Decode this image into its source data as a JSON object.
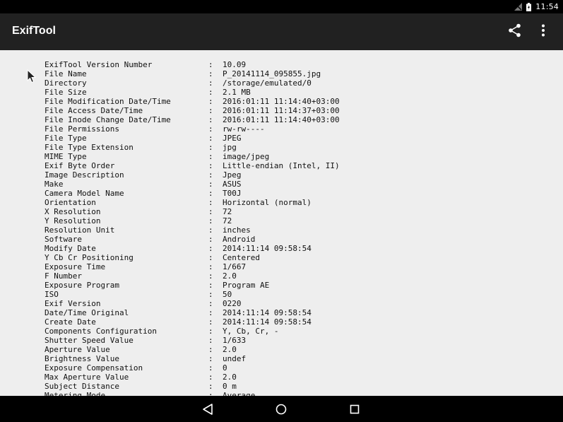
{
  "status_bar": {
    "time": "11:54"
  },
  "app_bar": {
    "title": "ExifTool"
  },
  "rows": [
    {
      "label": "ExifTool Version Number",
      "value": "10.09"
    },
    {
      "label": "File Name",
      "value": "P_20141114_095855.jpg"
    },
    {
      "label": "Directory",
      "value": "/storage/emulated/0"
    },
    {
      "label": "File Size",
      "value": "2.1 MB"
    },
    {
      "label": "File Modification Date/Time",
      "value": "2016:01:11 11:14:40+03:00"
    },
    {
      "label": "File Access Date/Time",
      "value": "2016:01:11 11:14:37+03:00"
    },
    {
      "label": "File Inode Change Date/Time",
      "value": "2016:01:11 11:14:40+03:00"
    },
    {
      "label": "File Permissions",
      "value": "rw-rw----"
    },
    {
      "label": "File Type",
      "value": "JPEG"
    },
    {
      "label": "File Type Extension",
      "value": "jpg"
    },
    {
      "label": "MIME Type",
      "value": "image/jpeg"
    },
    {
      "label": "Exif Byte Order",
      "value": "Little-endian (Intel, II)"
    },
    {
      "label": "Image Description",
      "value": "Jpeg"
    },
    {
      "label": "Make",
      "value": "ASUS"
    },
    {
      "label": "Camera Model Name",
      "value": "T00J"
    },
    {
      "label": "Orientation",
      "value": "Horizontal (normal)"
    },
    {
      "label": "X Resolution",
      "value": "72"
    },
    {
      "label": "Y Resolution",
      "value": "72"
    },
    {
      "label": "Resolution Unit",
      "value": "inches"
    },
    {
      "label": "Software",
      "value": "Android"
    },
    {
      "label": "Modify Date",
      "value": "2014:11:14 09:58:54"
    },
    {
      "label": "Y Cb Cr Positioning",
      "value": "Centered"
    },
    {
      "label": "Exposure Time",
      "value": "1/667"
    },
    {
      "label": "F Number",
      "value": "2.0"
    },
    {
      "label": "Exposure Program",
      "value": "Program AE"
    },
    {
      "label": "ISO",
      "value": "50"
    },
    {
      "label": "Exif Version",
      "value": "0220"
    },
    {
      "label": "Date/Time Original",
      "value": "2014:11:14 09:58:54"
    },
    {
      "label": "Create Date",
      "value": "2014:11:14 09:58:54"
    },
    {
      "label": "Components Configuration",
      "value": "Y, Cb, Cr, -"
    },
    {
      "label": "Shutter Speed Value",
      "value": "1/633"
    },
    {
      "label": "Aperture Value",
      "value": "2.0"
    },
    {
      "label": "Brightness Value",
      "value": "undef"
    },
    {
      "label": "Exposure Compensation",
      "value": "0"
    },
    {
      "label": "Max Aperture Value",
      "value": "2.0"
    },
    {
      "label": "Subject Distance",
      "value": "0 m"
    },
    {
      "label": "Metering Mode",
      "value": "Average"
    }
  ],
  "separator": ":"
}
